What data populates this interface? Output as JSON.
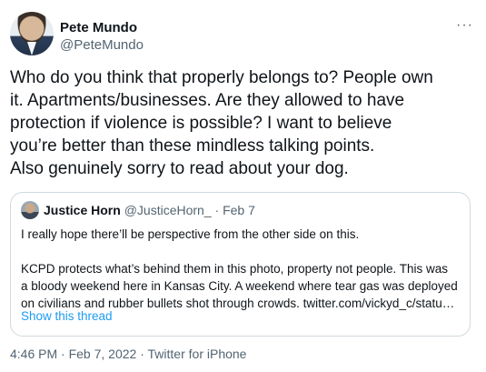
{
  "tweet": {
    "author": {
      "name": "Pete Mundo",
      "handle": "@PeteMundo"
    },
    "more_icon": "more-horizontal-icon",
    "text": "Who do you think that properly belongs to? People own\nit. Apartments/businesses. Are they allowed to have\nprotection if violence is possible? I want to believe\nyou’re better than these mindless talking points.\nAlso genuinely sorry to read about your dog.",
    "quoted": {
      "name": "Justice Horn",
      "handle": "@JusticeHorn_",
      "separator": "·",
      "date": "Feb 7",
      "text": "I really hope there’ll be perspective from the other side on this.\n\nKCPD protects what’s behind them in this photo, property not people. This was\na bloody weekend here in Kansas City. A weekend where tear gas was deployed\non civilians and rubber bullets shot through crowds. twitter.com/vickyd_c/statu…",
      "show_thread": "Show this thread"
    },
    "meta": {
      "time": "4:46 PM",
      "separator": "·",
      "date": "Feb 7, 2022",
      "source": "Twitter for iPhone"
    }
  },
  "colors": {
    "text": "#0f1419",
    "secondary": "#536471",
    "link": "#1d9bf0",
    "border": "#cfd9de"
  }
}
